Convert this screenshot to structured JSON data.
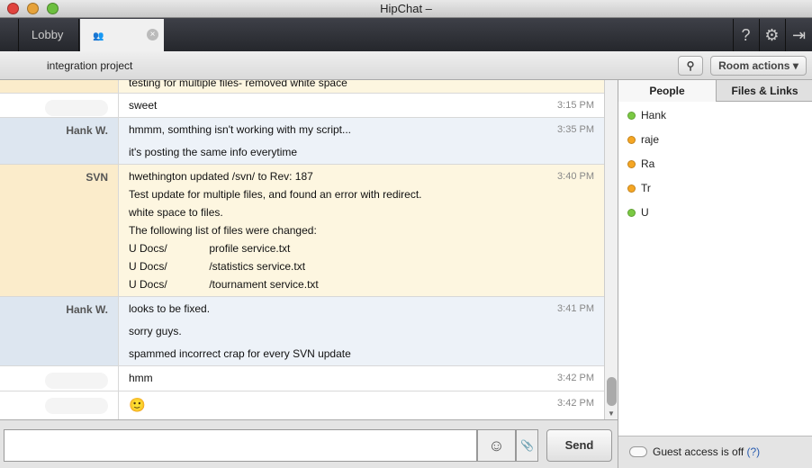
{
  "window": {
    "title": "HipChat –"
  },
  "tabs": [
    {
      "label": "Lobby"
    },
    {
      "label": ""
    }
  ],
  "room": {
    "topic": "integration project"
  },
  "toolbar": {
    "help": "?",
    "settings": "⚙",
    "exit": "⇥",
    "room_actions": "Room actions ▾",
    "search": "⚲"
  },
  "messages": [
    {
      "sender": "",
      "lines": [
        "testing for multiple files- removed white space"
      ],
      "time": ""
    },
    {
      "sender": "",
      "lines": [
        "sweet"
      ],
      "time": "3:15 PM"
    },
    {
      "sender": "Hank W.",
      "lines": [
        "hmmm, somthing isn't working with my script...",
        "it's posting the same info everytime"
      ],
      "time": "3:35 PM"
    },
    {
      "sender": "SVN",
      "lines": [
        "hwethington updated /svn/          to Rev: 187",
        "Test update for multiple files, and found an error with redirect.",
        "white space to files.",
        "The following list of files were changed:",
        "U Docs/              profile service.txt",
        "U Docs/              /statistics service.txt",
        "U Docs/              /tournament service.txt"
      ],
      "time": "3:40 PM"
    },
    {
      "sender": "Hank W.",
      "lines": [
        "looks to be fixed.",
        "sorry guys.",
        "spammed incorrect crap for every SVN update"
      ],
      "time": "3:41 PM"
    },
    {
      "sender": "",
      "lines": [
        "hmm"
      ],
      "time": "3:42 PM"
    },
    {
      "sender": "",
      "lines": [
        "🙂"
      ],
      "time": "3:42 PM"
    }
  ],
  "composer": {
    "value": "",
    "send": "Send",
    "emoticon": "☺",
    "attach": "📎"
  },
  "sidebar": {
    "tabs": [
      "People",
      "Files & Links"
    ],
    "people": [
      {
        "name": "Hank",
        "status": "#7ac943"
      },
      {
        "name": "raje",
        "status": "#f5a623"
      },
      {
        "name": "Ra",
        "status": "#f5a623"
      },
      {
        "name": "Tr",
        "status": "#f5a623"
      },
      {
        "name": "U",
        "status": "#7ac943"
      }
    ],
    "guest": "Guest access is off",
    "guest_help": "(?)"
  }
}
